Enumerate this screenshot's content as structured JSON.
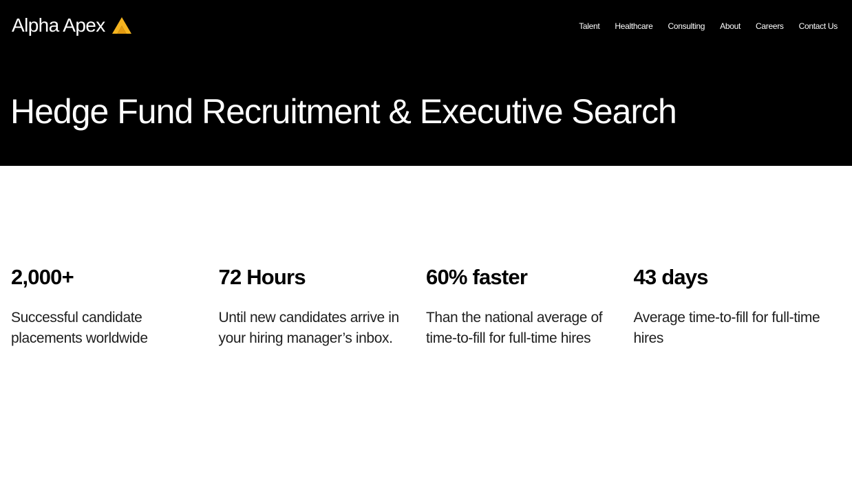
{
  "brand": {
    "name": "Alpha Apex",
    "logo_icon": "triangle-chevron-logo",
    "logo_color": "#F5B41F"
  },
  "nav": {
    "items": [
      {
        "label": "Talent"
      },
      {
        "label": "Healthcare"
      },
      {
        "label": "Consulting"
      },
      {
        "label": "About"
      },
      {
        "label": "Careers"
      },
      {
        "label": "Contact Us"
      }
    ]
  },
  "hero": {
    "title": "Hedge Fund Recruitment & Executive Search",
    "background": "#000000"
  },
  "stats": [
    {
      "value": "2,000+",
      "description": "Successful candidate placements worldwide"
    },
    {
      "value": "72 Hours",
      "description": "Until new candidates arrive in your hiring manager’s inbox."
    },
    {
      "value": "60% faster",
      "description": "Than the national average of time-to-fill for full-time hires"
    },
    {
      "value": "43 days",
      "description": "Average time-to-fill for full-time hires"
    }
  ]
}
